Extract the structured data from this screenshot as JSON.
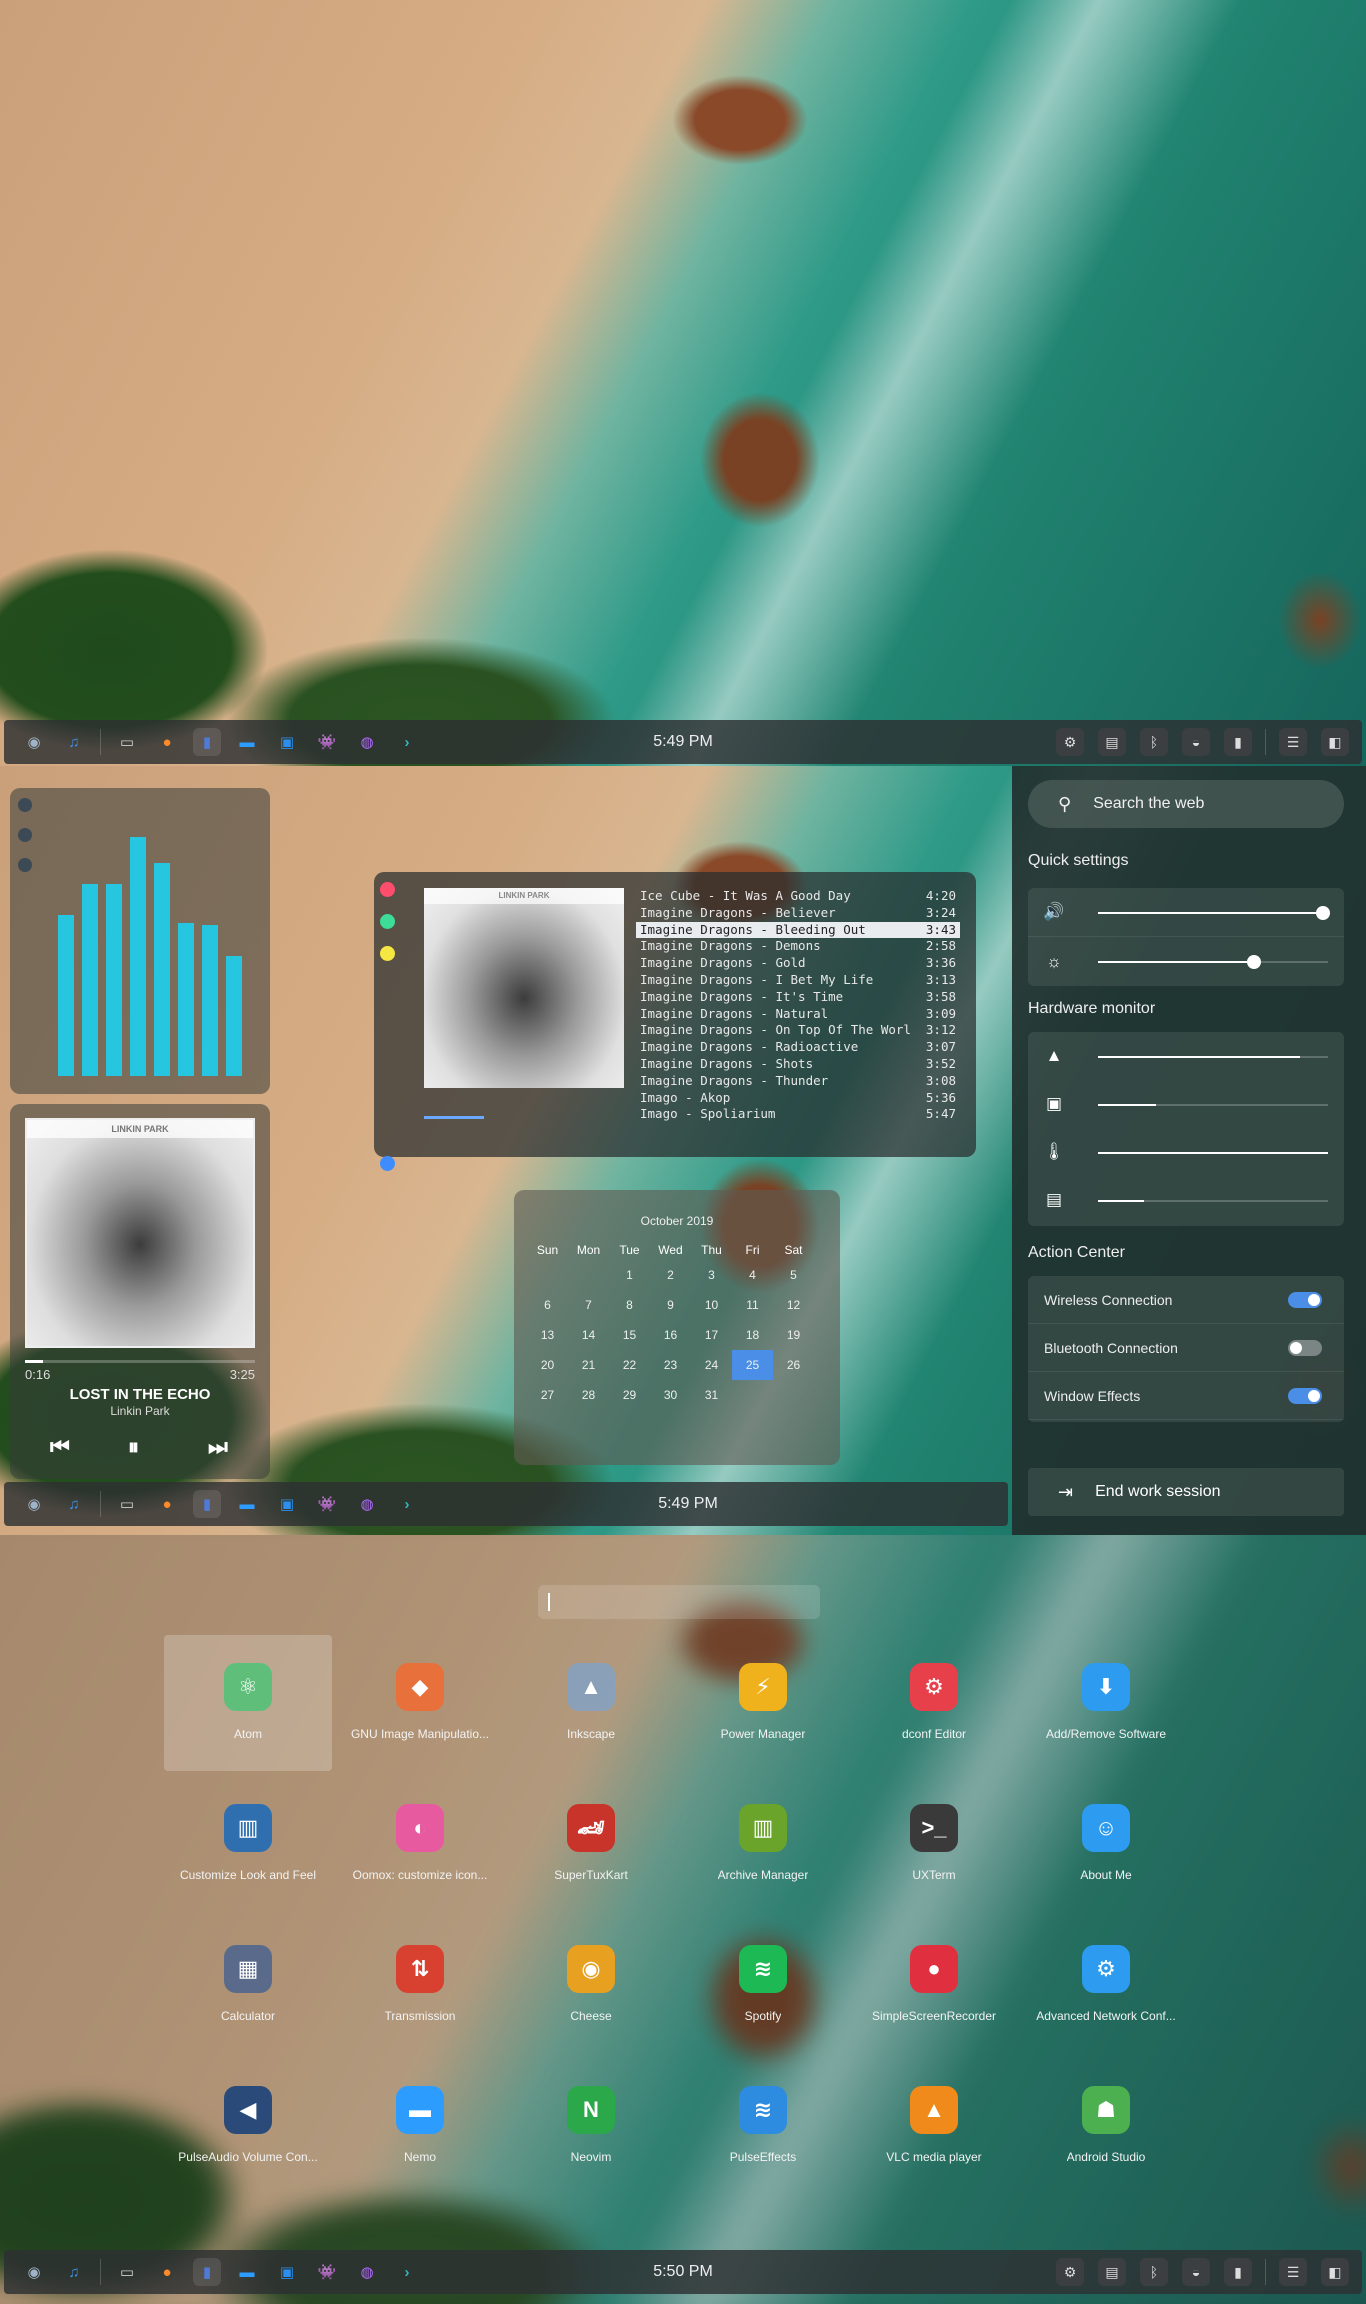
{
  "taskbar": {
    "launchers": [
      {
        "icon": "compass-icon",
        "glyph": "◉",
        "color": "#9fb4c8"
      },
      {
        "icon": "music-note-icon",
        "glyph": "♫",
        "color": "#3b8fe8"
      },
      {
        "icon": "terminal-icon",
        "glyph": "▭",
        "color": "#cfcfcf"
      },
      {
        "icon": "firefox-icon",
        "glyph": "●",
        "color": "#ff8a2a"
      },
      {
        "icon": "book-icon",
        "glyph": "▮",
        "color": "#4f7ad6"
      },
      {
        "icon": "folder-icon",
        "glyph": "▬",
        "color": "#2d9cff"
      },
      {
        "icon": "video-clapper-icon",
        "glyph": "▣",
        "color": "#2c8ff0"
      },
      {
        "icon": "space-invader-icon",
        "glyph": "👾",
        "color": "#e33fb3"
      },
      {
        "icon": "messenger-icon",
        "glyph": "◍",
        "color": "#b36bff"
      },
      {
        "icon": "code-editor-icon",
        "glyph": "›",
        "color": "#33b7c0"
      }
    ],
    "tray": [
      {
        "icon": "gear-icon",
        "glyph": "⚙"
      },
      {
        "icon": "drive-icon",
        "glyph": "▤"
      },
      {
        "icon": "bluetooth-icon",
        "glyph": "ᛒ"
      },
      {
        "icon": "wifi-icon",
        "glyph": "◒"
      },
      {
        "icon": "battery-icon",
        "glyph": "▮"
      }
    ],
    "end_buttons": [
      {
        "icon": "list-icon",
        "glyph": "☰"
      },
      {
        "icon": "panel-layout-icon",
        "glyph": "◧"
      }
    ],
    "clock_1": "5:49 PM",
    "clock_2": "5:49 PM",
    "clock_3": "5:50 PM"
  },
  "visualizer": {
    "levels": [
      0.62,
      0.74,
      0.74,
      0.92,
      0.82,
      0.59,
      0.58,
      0.46
    ],
    "bar_color": "#27c6e0"
  },
  "player": {
    "cover_text": "LINKIN PARK",
    "elapsed": "0:16",
    "duration": "3:25",
    "progress": 0.08,
    "title": "LOST IN THE ECHO",
    "artist": "Linkin Park",
    "prev_glyph": "⏮",
    "pause_glyph": "⏸",
    "next_glyph": "⏭"
  },
  "mpd": {
    "dot_colors": [
      "#ff4d6d",
      "#3ddc97",
      "#f5e642",
      "#3f8cff"
    ],
    "cover_text": "LINKIN PARK",
    "tracks": [
      {
        "name": "Ice Cube - It Was A Good Day",
        "time": "4:20"
      },
      {
        "name": "Imagine Dragons - Believer",
        "time": "3:24"
      },
      {
        "name": "Imagine Dragons - Bleeding Out",
        "time": "3:43",
        "selected": true
      },
      {
        "name": "Imagine Dragons - Demons",
        "time": "2:58"
      },
      {
        "name": "Imagine Dragons - Gold",
        "time": "3:36"
      },
      {
        "name": "Imagine Dragons - I Bet My Life",
        "time": "3:13"
      },
      {
        "name": "Imagine Dragons - It's Time",
        "time": "3:58"
      },
      {
        "name": "Imagine Dragons - Natural",
        "time": "3:09"
      },
      {
        "name": "Imagine Dragons - On Top Of The Worl",
        "time": "3:12"
      },
      {
        "name": "Imagine Dragons - Radioactive",
        "time": "3:07"
      },
      {
        "name": "Imagine Dragons - Shots",
        "time": "3:52"
      },
      {
        "name": "Imagine Dragons - Thunder",
        "time": "3:08"
      },
      {
        "name": "Imago - Akop",
        "time": "5:36"
      },
      {
        "name": "Imago - Spoliarium",
        "time": "5:47"
      }
    ]
  },
  "calendar": {
    "month": "October 2019",
    "days": [
      "Sun",
      "Mon",
      "Tue",
      "Wed",
      "Thu",
      "Fri",
      "Sat"
    ],
    "weeks": [
      [
        "",
        "",
        "1",
        "2",
        "3",
        "4",
        "5"
      ],
      [
        "6",
        "7",
        "8",
        "9",
        "10",
        "11",
        "12"
      ],
      [
        "13",
        "14",
        "15",
        "16",
        "17",
        "18",
        "19"
      ],
      [
        "20",
        "21",
        "22",
        "23",
        "24",
        "25",
        "26"
      ],
      [
        "27",
        "28",
        "29",
        "30",
        "31",
        "",
        ""
      ]
    ],
    "today": "25"
  },
  "sidebar": {
    "search_placeholder": "Search the web",
    "quick_settings_title": "Quick settings",
    "volume_level": 0.98,
    "brightness_level": 0.68,
    "hardware_title": "Hardware monitor",
    "cpu_level": 0.88,
    "memory_level": 0.25,
    "temperature_level": 1.0,
    "disk_level": 0.2,
    "action_center_title": "Action Center",
    "toggles": [
      {
        "label": "Wireless Connection",
        "on": true
      },
      {
        "label": "Bluetooth Connection",
        "on": false
      },
      {
        "label": "Window Effects",
        "on": true
      }
    ],
    "end_session": "End work session",
    "accent": "#4a8ee8"
  },
  "launcher": {
    "search_value": "",
    "apps": [
      {
        "name": "Atom",
        "icon": "atom-icon",
        "glyph": "⚛",
        "color": "#5fbf7a",
        "selected": true
      },
      {
        "name": "GNU Image Manipulatio...",
        "icon": "gimp-icon",
        "glyph": "◆",
        "color": "#e8703a"
      },
      {
        "name": "Inkscape",
        "icon": "inkscape-icon",
        "glyph": "▲",
        "color": "#8aa0b8"
      },
      {
        "name": "Power Manager",
        "icon": "power-manager-icon",
        "glyph": "⚡",
        "color": "#f0b21c"
      },
      {
        "name": "dconf Editor",
        "icon": "dconf-editor-icon",
        "glyph": "⚙",
        "color": "#e8404a"
      },
      {
        "name": "Add/Remove Software",
        "icon": "software-download-icon",
        "glyph": "⬇",
        "color": "#2d9cf0"
      },
      {
        "name": "Customize Look and Feel",
        "icon": "customize-look-icon",
        "glyph": "▥",
        "color": "#2f6fb0"
      },
      {
        "name": "Oomox: customize icon...",
        "icon": "oomox-icon",
        "glyph": "◐",
        "color": "#e85aa0"
      },
      {
        "name": "SuperTuxKart",
        "icon": "supertuxkart-icon",
        "glyph": "🏎",
        "color": "#c8332a"
      },
      {
        "name": "Archive Manager",
        "icon": "archive-manager-icon",
        "glyph": "▥",
        "color": "#6aa42a"
      },
      {
        "name": "UXTerm",
        "icon": "uxterm-icon",
        "glyph": ">_",
        "color": "#3a3a3a"
      },
      {
        "name": "About Me",
        "icon": "about-me-icon",
        "glyph": "☺",
        "color": "#2d9cf0"
      },
      {
        "name": "Calculator",
        "icon": "calculator-icon",
        "glyph": "▦",
        "color": "#5a6a8a"
      },
      {
        "name": "Transmission",
        "icon": "transmission-icon",
        "glyph": "⇅",
        "color": "#d84030"
      },
      {
        "name": "Cheese",
        "icon": "cheese-camera-icon",
        "glyph": "◉",
        "color": "#e8a020"
      },
      {
        "name": "Spotify",
        "icon": "spotify-icon",
        "glyph": "≋",
        "color": "#1db954"
      },
      {
        "name": "SimpleScreenRecorder",
        "icon": "screen-recorder-icon",
        "glyph": "●",
        "color": "#e03040"
      },
      {
        "name": "Advanced Network Conf...",
        "icon": "network-config-icon",
        "glyph": "⚙",
        "color": "#2d9cf0"
      },
      {
        "name": "PulseAudio Volume Con...",
        "icon": "speaker-icon",
        "glyph": "◀",
        "color": "#2a4a7a"
      },
      {
        "name": "Nemo",
        "icon": "folder-icon",
        "glyph": "▬",
        "color": "#2d9cff"
      },
      {
        "name": "Neovim",
        "icon": "neovim-icon",
        "glyph": "N",
        "color": "#2aa84a"
      },
      {
        "name": "PulseEffects",
        "icon": "pulseeffects-icon",
        "glyph": "≋",
        "color": "#2d8ce0"
      },
      {
        "name": "VLC media player",
        "icon": "vlc-cone-icon",
        "glyph": "▲",
        "color": "#f08a1a"
      },
      {
        "name": "Android Studio",
        "icon": "android-studio-icon",
        "glyph": "☗",
        "color": "#4caf50"
      }
    ]
  }
}
